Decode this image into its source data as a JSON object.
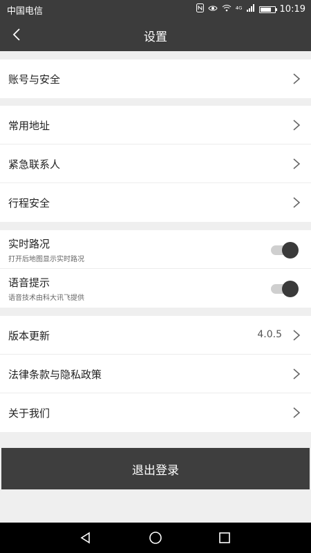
{
  "status": {
    "carrier": "中国电信",
    "signal": "⁴ᴳ",
    "time": "10:19"
  },
  "nav": {
    "title": "设置"
  },
  "groups": {
    "account": {
      "label": "账号与安全"
    },
    "common": [
      {
        "label": "常用地址"
      },
      {
        "label": "紧急联系人"
      },
      {
        "label": "行程安全"
      }
    ],
    "toggles": [
      {
        "label": "实时路况",
        "sub": "打开后地图显示实时路况",
        "on": true
      },
      {
        "label": "语音提示",
        "sub": "语音技术由科大讯飞提供",
        "on": true
      }
    ],
    "about": [
      {
        "label": "版本更新",
        "value": "4.0.5"
      },
      {
        "label": "法律条款与隐私政策"
      },
      {
        "label": "关于我们"
      }
    ]
  },
  "logout": {
    "label": "退出登录"
  }
}
